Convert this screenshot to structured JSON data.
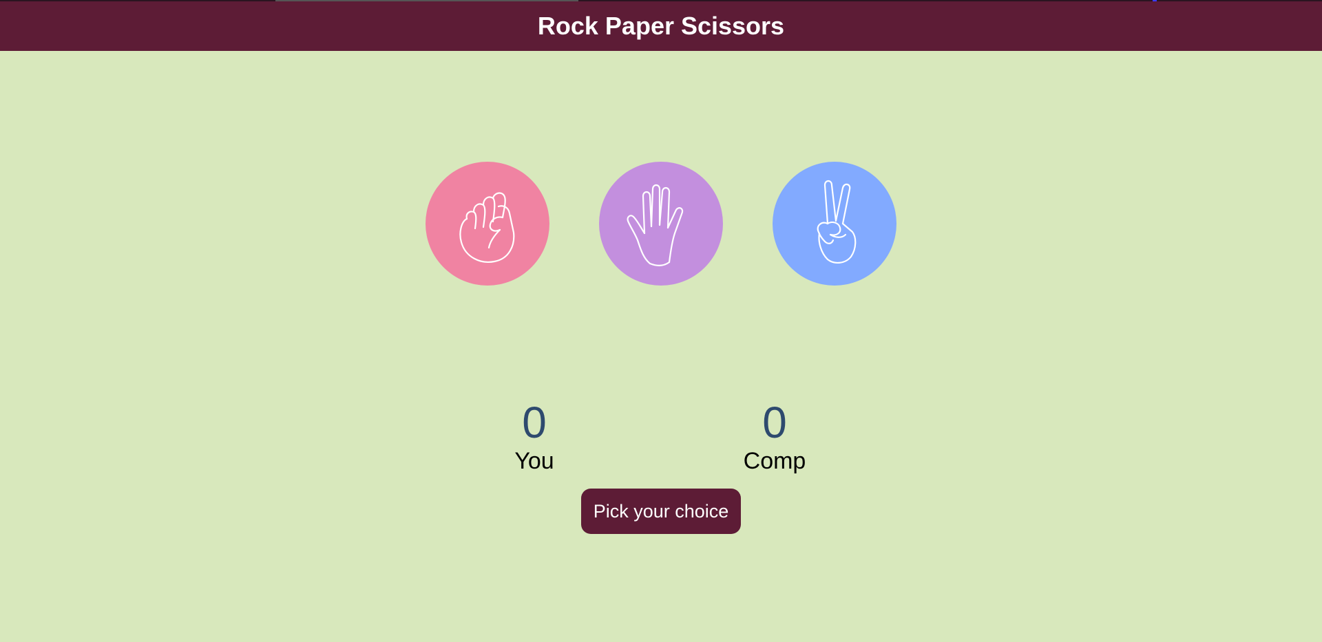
{
  "header": {
    "title": "Rock Paper Scissors",
    "background": "#5d1c36"
  },
  "page": {
    "background": "#d8e8bc"
  },
  "choices": [
    {
      "id": "rock",
      "icon": "fist-hand-icon",
      "color": "#f083a2"
    },
    {
      "id": "paper",
      "icon": "open-hand-icon",
      "color": "#c38fde"
    },
    {
      "id": "scissors",
      "icon": "peace-sign-hand-icon",
      "color": "#82aaff"
    }
  ],
  "scoreboard": {
    "user": {
      "score": "0",
      "label": "You"
    },
    "comp": {
      "score": "0",
      "label": "Comp"
    },
    "score_color": "#2e4a6e"
  },
  "message": {
    "text": "Pick your choice"
  }
}
